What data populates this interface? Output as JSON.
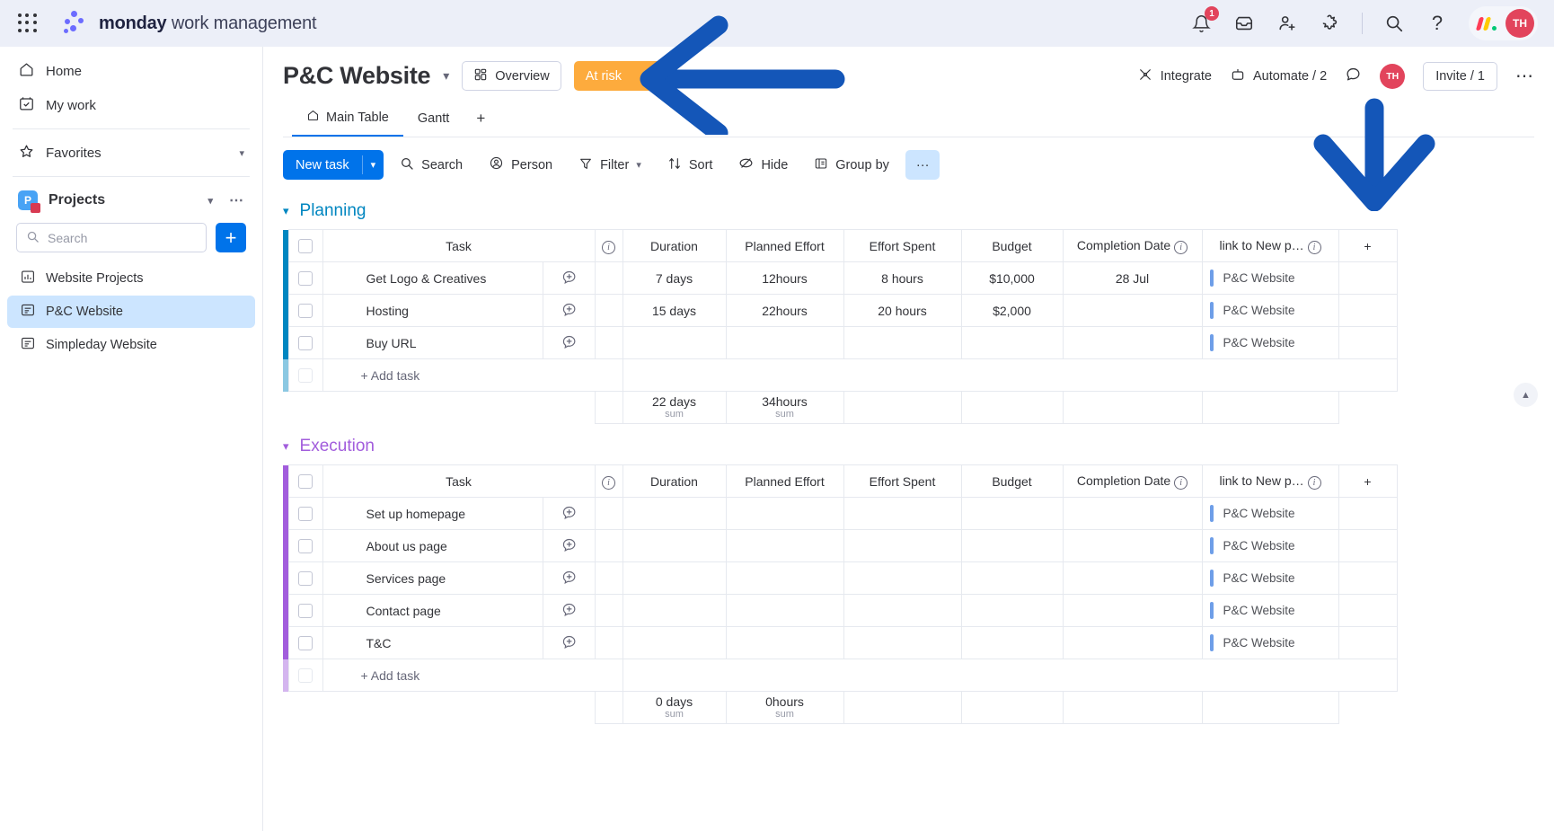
{
  "topbar": {
    "apps_icon": "apps-grid-icon",
    "brand_bold": "monday",
    "brand_light": " work management",
    "notifications_count": "1",
    "icons": [
      "bell-icon",
      "inbox-icon",
      "invite-member-icon",
      "apps-marketplace-icon",
      "search-icon",
      "help-icon"
    ],
    "help_label": "?",
    "avatar_initials": "TH"
  },
  "sidebar": {
    "nav": [
      {
        "label": "Home",
        "icon": "home-icon"
      },
      {
        "label": "My work",
        "icon": "my-work-icon"
      }
    ],
    "favorites": {
      "label": "Favorites",
      "icon": "star-icon"
    },
    "projects": {
      "label": "Projects",
      "icon": "workspace-icon",
      "initial": "P"
    },
    "search": {
      "placeholder": "Search",
      "value": ""
    },
    "add_button": "+",
    "boards": [
      {
        "label": "Website Projects",
        "icon": "dashboard-icon",
        "active": false
      },
      {
        "label": "P&C Website",
        "icon": "board-icon",
        "active": true
      },
      {
        "label": "Simpleday Website",
        "icon": "board-icon",
        "active": false
      }
    ]
  },
  "board": {
    "title": "P&C Website",
    "overview_label": "Overview",
    "status_label": "At risk",
    "status_color": "#fdab3d",
    "integrate_label": "Integrate",
    "automate_label": "Automate / 2",
    "invite_label": "Invite / 1",
    "avatar_initials": "TH",
    "tabs": [
      {
        "label": "Main Table",
        "icon": "home-icon",
        "active": true
      },
      {
        "label": "Gantt",
        "icon": "",
        "active": false
      }
    ],
    "tab_add": "+"
  },
  "toolbar": {
    "new_task_label": "New task",
    "buttons": [
      {
        "label": "Search",
        "icon": "search-icon"
      },
      {
        "label": "Person",
        "icon": "person-icon"
      },
      {
        "label": "Filter",
        "icon": "filter-icon"
      },
      {
        "label": "Sort",
        "icon": "sort-icon"
      },
      {
        "label": "Hide",
        "icon": "hide-icon"
      },
      {
        "label": "Group by",
        "icon": "group-by-icon"
      }
    ],
    "more_label": "···"
  },
  "columns": [
    "Task",
    "Duration",
    "Planned Effort",
    "Effort Spent",
    "Budget",
    "Completion Date",
    "link to New p…"
  ],
  "add_column_label": "+",
  "add_task_label": "+ Add task",
  "sum_label": "sum",
  "groups": [
    {
      "name": "Planning",
      "color": "#0086c0",
      "rows": [
        {
          "task": "Get Logo & Creatives",
          "duration": "7 days",
          "planned_effort": "12hours",
          "effort_spent": "8 hours",
          "budget": "$10,000",
          "completion_date": "28 Jul",
          "link": "P&C Website"
        },
        {
          "task": "Hosting",
          "duration": "15 days",
          "planned_effort": "22hours",
          "effort_spent": "20 hours",
          "budget": "$2,000",
          "completion_date": "",
          "link": "P&C Website"
        },
        {
          "task": "Buy URL",
          "duration": "",
          "planned_effort": "",
          "effort_spent": "",
          "budget": "",
          "completion_date": "",
          "link": "P&C Website"
        }
      ],
      "summary": {
        "duration": "22 days",
        "planned_effort": "34hours"
      }
    },
    {
      "name": "Execution",
      "color": "#a25ddc",
      "rows": [
        {
          "task": "Set up homepage",
          "duration": "",
          "planned_effort": "",
          "effort_spent": "",
          "budget": "",
          "completion_date": "",
          "link": "P&C Website"
        },
        {
          "task": "About us page",
          "duration": "",
          "planned_effort": "",
          "effort_spent": "",
          "budget": "",
          "completion_date": "",
          "link": "P&C Website"
        },
        {
          "task": "Services page",
          "duration": "",
          "planned_effort": "",
          "effort_spent": "",
          "budget": "",
          "completion_date": "",
          "link": "P&C Website"
        },
        {
          "task": "Contact page",
          "duration": "",
          "planned_effort": "",
          "effort_spent": "",
          "budget": "",
          "completion_date": "",
          "link": "P&C Website"
        },
        {
          "task": "T&C",
          "duration": "",
          "planned_effort": "",
          "effort_spent": "",
          "budget": "",
          "completion_date": "",
          "link": "P&C Website"
        }
      ],
      "summary": {
        "duration": "0 days",
        "planned_effort": "0hours"
      }
    }
  ],
  "annotations": {
    "color": "#1456b8",
    "left_arrow": "arrow-pointing-left",
    "down_arrow": "arrow-pointing-down"
  }
}
